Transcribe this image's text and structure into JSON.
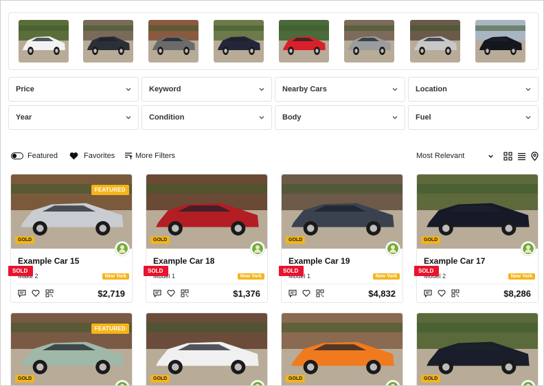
{
  "colors": {
    "accent": "#f5b41a",
    "sold": "#e8132d",
    "border": "#e2e2e2"
  },
  "thumbnails": [
    {
      "name": "white coupe thumbnail",
      "body": "#f2f2f2",
      "bg": "#5b6e3a"
    },
    {
      "name": "black suv thumbnail",
      "body": "#2b2f38",
      "bg": "#7a6a58"
    },
    {
      "name": "grey coupe thumbnail",
      "body": "#6b6b6b",
      "bg": "#8a5a40"
    },
    {
      "name": "dark convertible thumbnail",
      "body": "#23263a",
      "bg": "#6d7a4a"
    },
    {
      "name": "red hatchback thumbnail",
      "body": "#d8202a",
      "bg": "#4a6a3a"
    },
    {
      "name": "grey suv thumbnail",
      "body": "#9a9c9e",
      "bg": "#7c6a5a"
    },
    {
      "name": "silver coupe thumbnail",
      "body": "#c8c8c8",
      "bg": "#6a5a4a"
    },
    {
      "name": "black grand tourer thumbnail",
      "body": "#14161e",
      "bg": "#a8b6c4"
    }
  ],
  "filters": {
    "row1": [
      "Price",
      "Keyword",
      "Nearby Cars",
      "Location"
    ],
    "row2": [
      "Year",
      "Condition",
      "Body",
      "Fuel"
    ]
  },
  "toolbar": {
    "featured": "Featured",
    "favorites": "Favorites",
    "more_filters": "More Filters",
    "sort": "Most Relevant"
  },
  "cards": [
    {
      "title": "Example Car 15",
      "model": "Make 2",
      "city": "New York",
      "price": "$2,719",
      "featured": "FEATURED",
      "gold": "GOLD",
      "sold": "SOLD",
      "body": "#c9ccd0",
      "bg": "#7b5a3c"
    },
    {
      "title": "Example Car 18",
      "model": "Model 1",
      "city": "New York",
      "price": "$1,376",
      "featured": "",
      "gold": "GOLD",
      "sold": "SOLD",
      "body": "#b31d24",
      "bg": "#6a4a34"
    },
    {
      "title": "Example Car 19",
      "model": "Model 1",
      "city": "New York",
      "price": "$4,832",
      "featured": "",
      "gold": "GOLD",
      "sold": "SOLD",
      "body": "#3a4250",
      "bg": "#6e5a48"
    },
    {
      "title": "Example Car 17",
      "model": "Model 2",
      "city": "New York",
      "price": "$8,286",
      "featured": "",
      "gold": "GOLD",
      "sold": "SOLD",
      "body": "#161a28",
      "bg": "#5e6a3c"
    },
    {
      "title": "",
      "model": "",
      "city": "",
      "price": "",
      "featured": "FEATURED",
      "gold": "GOLD",
      "sold": "",
      "body": "#9fb8a8",
      "bg": "#7a5a44"
    },
    {
      "title": "",
      "model": "",
      "city": "",
      "price": "",
      "featured": "",
      "gold": "GOLD",
      "sold": "",
      "body": "#f0f0f0",
      "bg": "#6b4c3a"
    },
    {
      "title": "",
      "model": "",
      "city": "",
      "price": "",
      "featured": "",
      "gold": "GOLD",
      "sold": "",
      "body": "#f07a1e",
      "bg": "#8a6a50"
    },
    {
      "title": "",
      "model": "",
      "city": "",
      "price": "",
      "featured": "",
      "gold": "GOLD",
      "sold": "",
      "body": "#1a1d2a",
      "bg": "#5a6a3a"
    }
  ]
}
